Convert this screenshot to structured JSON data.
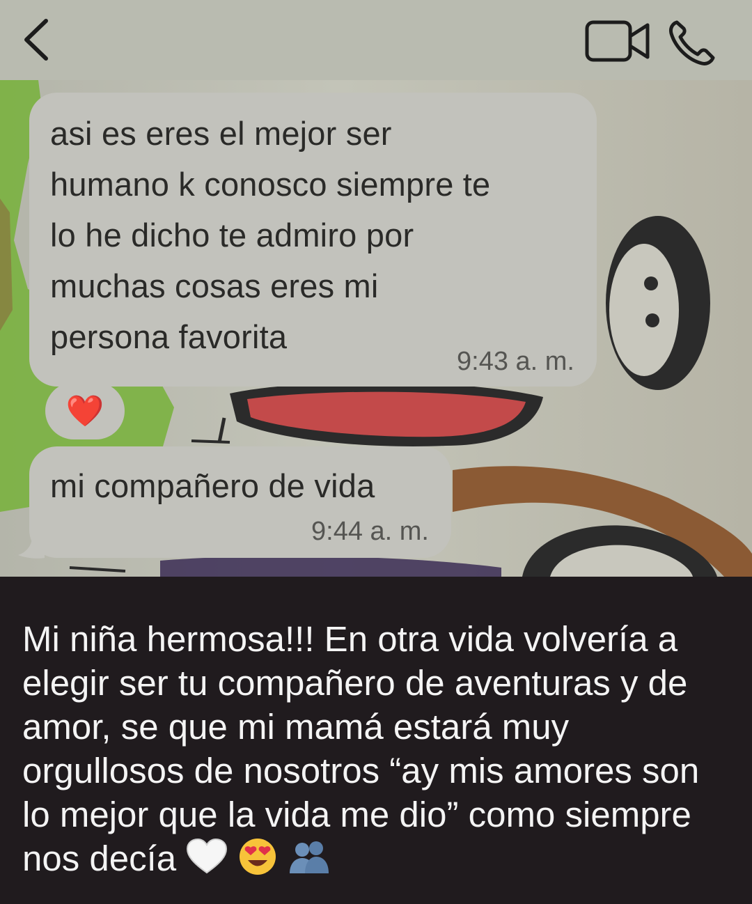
{
  "header": {
    "back_icon": "chevron-left-icon",
    "video_icon": "video-camera-icon",
    "phone_icon": "phone-icon"
  },
  "messages": [
    {
      "text": "asi es eres el mejor ser\nhumano k conosco siempre te\nlo he dicho te admiro por\nmuchas cosas eres mi\npersona favorita",
      "time": "9:43 a. m.",
      "reaction": "❤️"
    },
    {
      "text": "mi compañero de vida",
      "time": "9:44 a. m."
    }
  ],
  "caption": {
    "text": "Mi niña hermosa!!! En otra vida volvería a\nelegir ser tu compañero de aventuras y de\namor, se que mi mamá estará muy\norgullosos de nosotros “ay mis amores son\nlo mejor que la vida me dio” como siempre\nnos decía",
    "emojis": [
      "white-heart-emoji",
      "heart-eyes-emoji",
      "busts-in-silhouette-emoji"
    ]
  },
  "colors": {
    "header_bg": "#b9bbb0",
    "bubble_bg": "#c2c2bc",
    "caption_bg": "#201b1e",
    "caption_text": "#f4f4f4"
  }
}
